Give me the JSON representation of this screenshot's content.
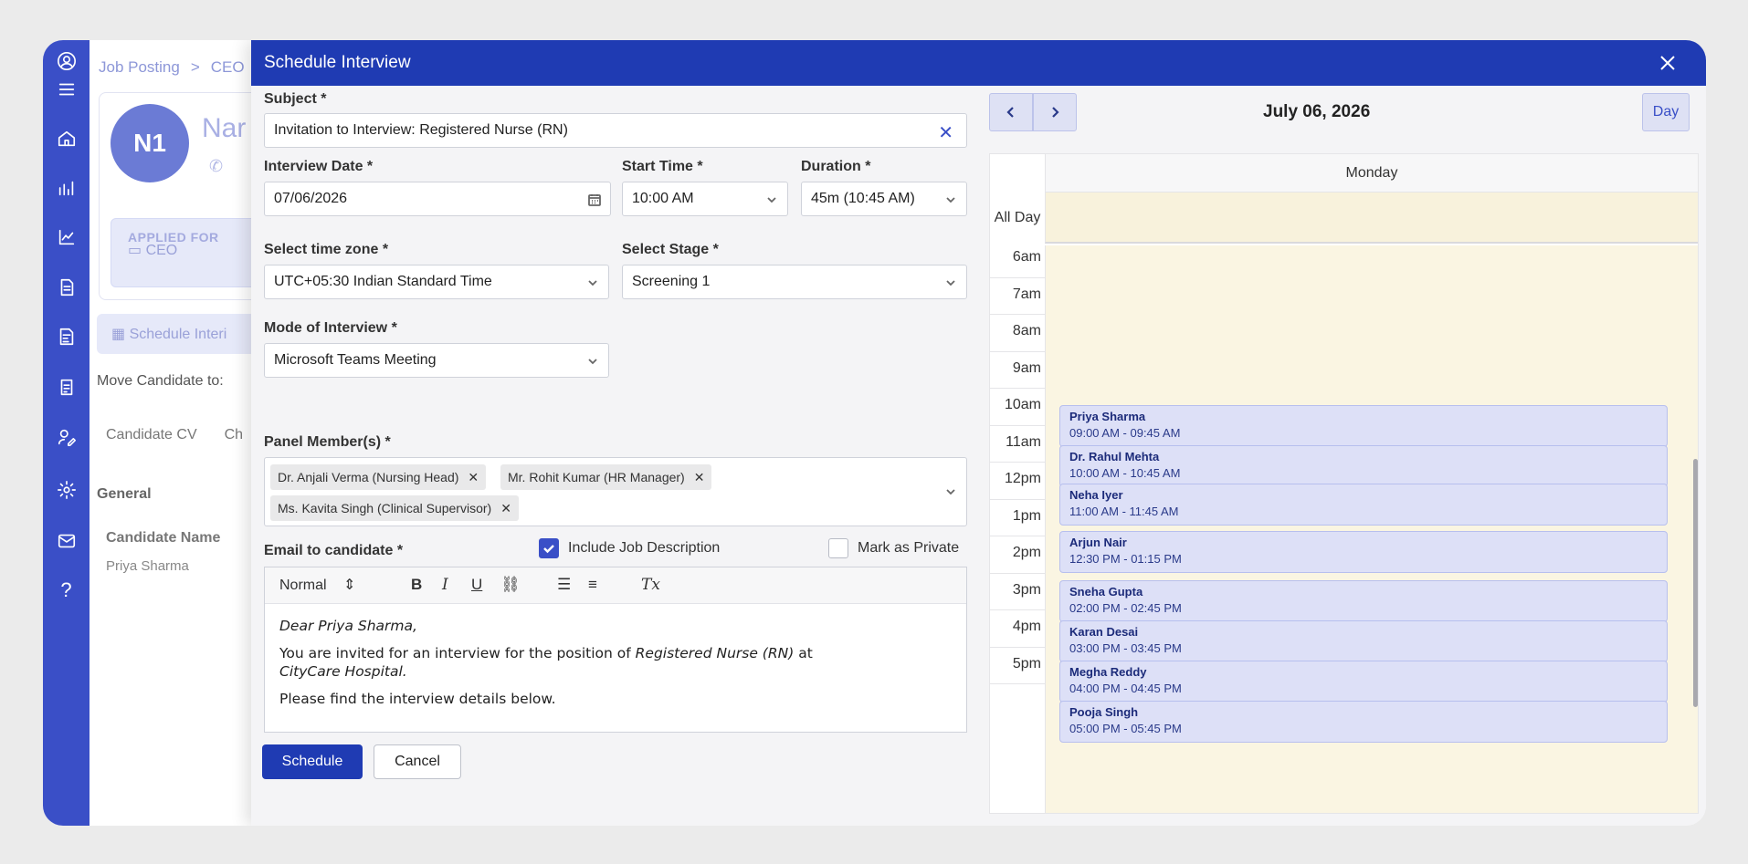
{
  "background": {
    "breadcrumb": [
      "Job Posting",
      ">",
      "CEO"
    ],
    "avatar_initials": "N1",
    "name_partial": "Nar",
    "applied_for_label": "APPLIED FOR",
    "applied_for_value": "CEO",
    "schedule_button": "Schedule Interi",
    "move_candidate": "Move Candidate to:",
    "tabs": [
      "Candidate CV",
      "Ch"
    ],
    "section": "General",
    "candidate_name_label": "Candidate Name",
    "candidate_name_value": "Priya Sharma"
  },
  "dialog": {
    "title": "Schedule Interview",
    "subject_label": "Subject *",
    "subject_value": "Invitation to Interview: Registered Nurse (RN)",
    "date_label": "Interview Date *",
    "date_value": "07/06/2026",
    "start_label": "Start Time *",
    "start_value": "10:00 AM",
    "duration_label": "Duration *",
    "duration_value": "45m (10:45 AM)",
    "timezone_label": "Select time zone *",
    "timezone_value": "UTC+05:30 Indian Standard Time",
    "stage_label": "Select Stage *",
    "stage_value": "Screening 1",
    "mode_label": "Mode of Interview *",
    "mode_value": "Microsoft Teams Meeting",
    "panel_label": "Panel Member(s) *",
    "panel_members": [
      "Dr. Anjali Verma (Nursing Head)",
      "Mr. Rohit Kumar (HR Manager)",
      "Ms. Kavita Singh (Clinical Supervisor)"
    ],
    "email_label": "Email to candidate *",
    "include_jd_label": "Include Job Description",
    "include_jd_checked": true,
    "private_label": "Mark as Private",
    "private_checked": false,
    "format_select": "Normal",
    "email_greeting": "Dear Priya Sharma,",
    "email_line1": "You are invited for an interview for the position of",
    "email_position": "Registered Nurse (RN)",
    "email_at": "at",
    "email_org": "CityCare Hospital.",
    "email_line2": "Please find the interview details below.",
    "schedule_button": "Schedule",
    "cancel_button": "Cancel"
  },
  "calendar": {
    "date_title": "July 06, 2026",
    "view_button": "Day",
    "day_header": "Monday",
    "all_day_label": "All Day",
    "hours": [
      "6am",
      "7am",
      "8am",
      "9am",
      "10am",
      "11am",
      "12pm",
      "1pm",
      "2pm",
      "3pm",
      "4pm",
      "5pm"
    ],
    "events": [
      {
        "name": "Priya Sharma",
        "time": "09:00 AM - 09:45 AM"
      },
      {
        "name": "Dr. Rahul Mehta",
        "time": "10:00 AM - 10:45 AM"
      },
      {
        "name": "Neha Iyer",
        "time": "11:00 AM - 11:45 AM"
      },
      {
        "name": "Arjun Nair",
        "time": "12:30 PM - 01:15 PM"
      },
      {
        "name": "Sneha Gupta",
        "time": "02:00 PM - 02:45 PM"
      },
      {
        "name": "Karan Desai",
        "time": "03:00 PM - 03:45 PM"
      },
      {
        "name": "Megha Reddy",
        "time": "04:00 PM - 04:45 PM"
      },
      {
        "name": "Pooja Singh",
        "time": "05:00 PM - 05:45 PM"
      }
    ]
  },
  "colors": {
    "brand": "#1f3bb3",
    "rail": "#3a4fc7",
    "event": "#dde0f7",
    "day_bg": "#faf5e2"
  }
}
